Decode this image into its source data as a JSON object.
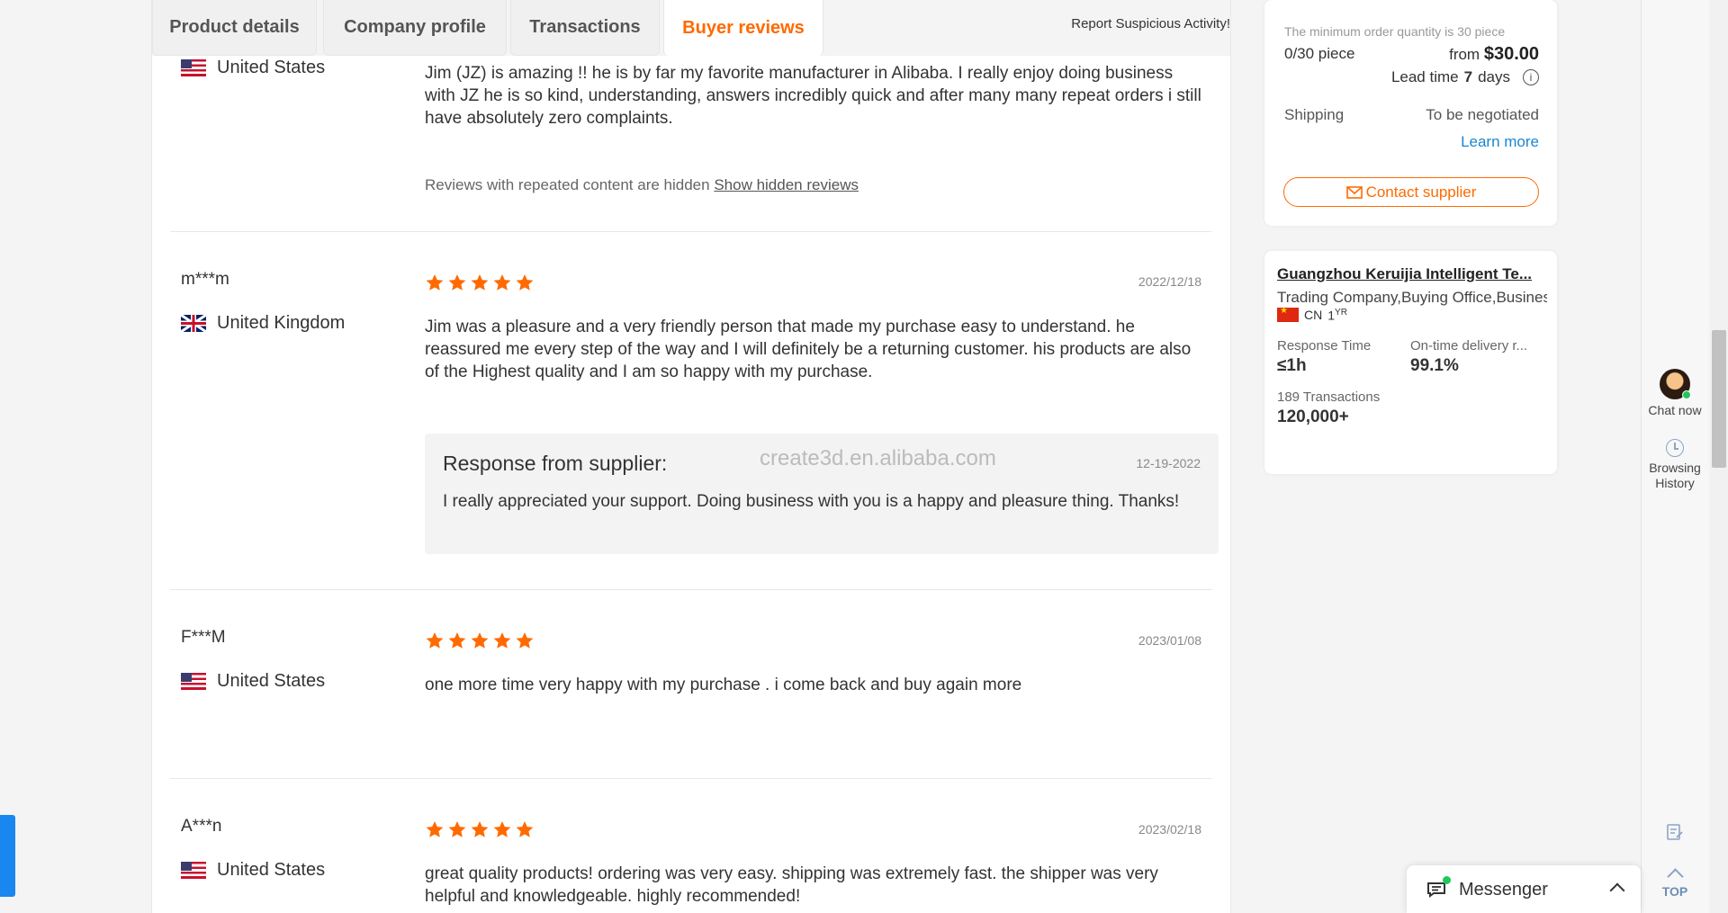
{
  "tabs": [
    {
      "label": "Product details"
    },
    {
      "label": "Company profile"
    },
    {
      "label": "Transactions"
    },
    {
      "label": "Buyer reviews"
    }
  ],
  "report_link": "Report Suspicious Activity!",
  "reviews": [
    {
      "name": "",
      "country": "United States",
      "date": "",
      "text": "Jim (JZ) is amazing !! he is by far my favorite manufacturer in Alibaba. I really enjoy doing business with JZ he is so kind, understanding, answers incredibly quick and after many many repeat orders i still have absolutely zero complaints.",
      "hidden_note": "Reviews with repeated content are hidden",
      "hidden_link": "Show hidden reviews"
    },
    {
      "name": "m***m",
      "country": "United Kingdom",
      "date": "2022/12/18",
      "rating": 5,
      "text": "Jim was a pleasure and a very friendly person that made my purchase easy to understand. he reassured me every step of the way and I will definitely be a returning customer. his products are also of the Highest quality and I am so happy with my purchase.",
      "response": {
        "title": "Response from supplier:",
        "date": "12-19-2022",
        "watermark": "create3d.en.alibaba.com",
        "text": "I really appreciated your support. Doing business with you is a happy and pleasure thing. Thanks!"
      }
    },
    {
      "name": "F***M",
      "country": "United States",
      "date": "2023/01/08",
      "rating": 5,
      "text": "one more time very happy with my purchase . i come back and buy again more"
    },
    {
      "name": "A***n",
      "country": "United States",
      "date": "2023/02/18",
      "rating": 5,
      "text": "great quality products! ordering was very easy. shipping was extremely fast. the shipper was very helpful and knowledgeable. highly recommended!"
    }
  ],
  "order": {
    "moq_note": "The minimum order quantity is 30 piece",
    "quantity": "0/30 piece",
    "price_prefix": "from",
    "price": "$30.00",
    "lead_prefix": "Lead time",
    "lead_days": "7",
    "lead_suffix": "days",
    "shipping_label": "Shipping",
    "shipping_value": "To be negotiated",
    "learn_more": "Learn more",
    "contact_button": "Contact supplier"
  },
  "company": {
    "name": "Guangzhou Keruijia Intelligent Te...",
    "type": "Trading Company,Buying Office,Business",
    "country_code": "CN",
    "years": "1",
    "years_unit": "YR",
    "response_label": "Response Time",
    "response_value": "≤1h",
    "ontime_label": "On-time delivery r...",
    "ontime_value": "99.1%",
    "transactions_label": "189 Transactions",
    "transactions_value": "120,000+"
  },
  "rail": {
    "chat_now": "Chat now",
    "browsing_history_line1": "Browsing",
    "browsing_history_line2": "History",
    "top": "TOP"
  },
  "messenger": {
    "label": "Messenger"
  },
  "colors": {
    "accent": "#ff6a00",
    "link": "#1a86d0",
    "star": "#ff6a00"
  }
}
